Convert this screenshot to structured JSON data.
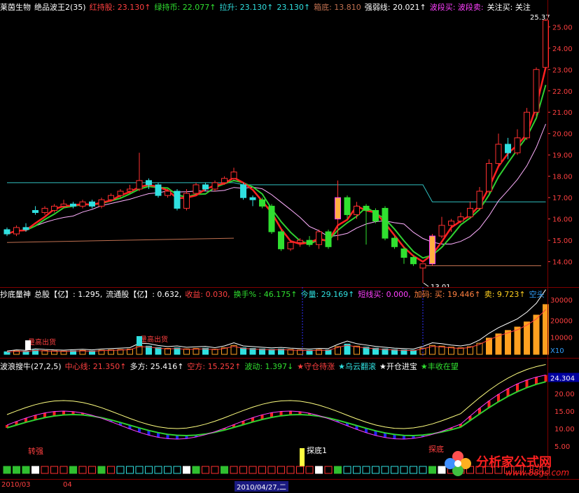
{
  "main_header": {
    "stock": "莱茵生物",
    "indicator": "绝品波王2(35)",
    "items": [
      {
        "label": "红持股: 23.130↑",
        "color": "#ff4040"
      },
      {
        "label": "绿持币: 22.077↑",
        "color": "#30e030"
      },
      {
        "label": "拉升: 23.130↑",
        "color": "#30e0e0"
      },
      {
        "label": "23.130↑",
        "color": "#30e0e0"
      },
      {
        "label": "箱底: 13.810",
        "color": "#c07050"
      },
      {
        "label": "强弱线: 20.021↑",
        "color": "#ffffff"
      },
      {
        "label": "波段买: 波段卖:",
        "color": "#ff40ff"
      },
      {
        "label": "关注买: 关注",
        "color": "#ffffff"
      }
    ]
  },
  "vol_header": {
    "items": [
      {
        "label": "抄底量神",
        "color": "#ffffff"
      },
      {
        "label": "总股【亿】: 1.295,",
        "color": "#ffffff"
      },
      {
        "label": "流通股【亿】: 0.632,",
        "color": "#ffffff"
      },
      {
        "label": "收益: 0.030,",
        "color": "#ff4040"
      },
      {
        "label": "换手% : 46.175↑",
        "color": "#30e030"
      },
      {
        "label": "今量: 29.169↑",
        "color": "#30e0e0"
      },
      {
        "label": "短线买: 0.000,",
        "color": "#ff40ff"
      },
      {
        "label": "加码: 买: 19.446↑",
        "color": "#ff8040"
      },
      {
        "label": "卖: 9.723↑",
        "color": "#ffd020"
      },
      {
        "label": "空头",
        "color": "#30a0ff"
      }
    ]
  },
  "wave_header": {
    "items": [
      {
        "label": "波浪搜牛(27,2,5)",
        "color": "#ffffff"
      },
      {
        "label": "中心线: 21.350↑",
        "color": "#ff4040"
      },
      {
        "label": "多方: 25.416↑",
        "color": "#ffffff"
      },
      {
        "label": "空方: 15.252↑",
        "color": "#ff4040"
      },
      {
        "label": "波动: 1.397↓",
        "color": "#30e030"
      },
      {
        "label": "★守仓待涨",
        "color": "#ff4040"
      },
      {
        "label": "★乌云翻滚",
        "color": "#30e0e0"
      },
      {
        "label": "★开仓进宝",
        "color": "#ffffff"
      },
      {
        "label": "★丰收在望",
        "color": "#30e030"
      }
    ]
  },
  "price_axis": [
    "25.00",
    "24.00",
    "23.00",
    "22.00",
    "21.00",
    "20.00",
    "19.00",
    "18.00",
    "17.00",
    "16.00",
    "15.00",
    "14.00"
  ],
  "vol_axis": [
    "30000",
    "20000",
    "10000",
    "X10"
  ],
  "wave_axis": [
    "24.304",
    "20.00",
    "15.00",
    "10.00",
    "5.00"
  ],
  "annotations": {
    "high_price": "25.37",
    "low_price": "13.01",
    "vol_note1": "量高出货",
    "vol_note2": "量高出货",
    "wave_note1": "转强",
    "wave_note2": "探底1",
    "wave_note3": "探底"
  },
  "dates": {
    "d1": "2010/03",
    "d2": "04",
    "d3": "2010/04/27,二"
  },
  "logo": {
    "title": "分析家公式网",
    "url": "www.88gs.com"
  },
  "candles": [
    {
      "o": 15.5,
      "c": 15.3,
      "h": 15.6,
      "l": 15.2
    },
    {
      "o": 15.3,
      "c": 15.6,
      "h": 15.7,
      "l": 15.2
    },
    {
      "o": 15.6,
      "c": 15.5,
      "h": 15.8,
      "l": 15.4
    },
    {
      "o": 16.4,
      "c": 16.3,
      "h": 16.6,
      "l": 16.2
    },
    {
      "o": 16.3,
      "c": 16.5,
      "h": 16.6,
      "l": 16.2
    },
    {
      "o": 16.4,
      "c": 16.6,
      "h": 16.7,
      "l": 16.3
    },
    {
      "o": 16.6,
      "c": 16.7,
      "h": 16.9,
      "l": 16.5
    },
    {
      "o": 16.7,
      "c": 16.6,
      "h": 16.8,
      "l": 16.5
    },
    {
      "o": 16.6,
      "c": 16.8,
      "h": 16.9,
      "l": 16.5
    },
    {
      "o": 16.8,
      "c": 16.6,
      "h": 16.9,
      "l": 16.5
    },
    {
      "o": 16.6,
      "c": 16.9,
      "h": 17.0,
      "l": 16.5
    },
    {
      "o": 16.9,
      "c": 17.1,
      "h": 17.2,
      "l": 16.8
    },
    {
      "o": 17.1,
      "c": 17.3,
      "h": 17.4,
      "l": 17.0
    },
    {
      "o": 17.3,
      "c": 17.4,
      "h": 17.6,
      "l": 17.2
    },
    {
      "o": 17.4,
      "c": 17.8,
      "h": 19.1,
      "l": 17.3
    },
    {
      "o": 17.8,
      "c": 17.6,
      "h": 17.9,
      "l": 17.4
    },
    {
      "o": 17.6,
      "c": 17.1,
      "h": 17.7,
      "l": 17.0
    },
    {
      "o": 17.1,
      "c": 17.3,
      "h": 17.4,
      "l": 17.0
    },
    {
      "o": 17.3,
      "c": 16.5,
      "h": 17.4,
      "l": 16.4
    },
    {
      "o": 16.5,
      "c": 17.2,
      "h": 17.4,
      "l": 16.4
    },
    {
      "o": 17.2,
      "c": 17.6,
      "h": 17.7,
      "l": 17.1
    },
    {
      "o": 17.6,
      "c": 17.4,
      "h": 17.7,
      "l": 17.3
    },
    {
      "o": 17.4,
      "c": 17.7,
      "h": 17.8,
      "l": 17.3
    },
    {
      "o": 17.7,
      "c": 17.9,
      "h": 18.0,
      "l": 17.6
    },
    {
      "o": 17.9,
      "c": 18.2,
      "h": 18.4,
      "l": 17.8
    },
    {
      "o": 17.6,
      "c": 17.0,
      "h": 17.7,
      "l": 16.9
    },
    {
      "o": 17.0,
      "c": 16.9,
      "h": 17.1,
      "l": 16.6
    },
    {
      "o": 16.9,
      "c": 16.6,
      "h": 17.0,
      "l": 16.5
    },
    {
      "o": 16.6,
      "c": 15.4,
      "h": 16.7,
      "l": 15.3
    },
    {
      "o": 15.4,
      "c": 14.6,
      "h": 15.5,
      "l": 14.5
    },
    {
      "o": 14.6,
      "c": 14.9,
      "h": 15.0,
      "l": 14.5
    },
    {
      "o": 14.9,
      "c": 15.0,
      "h": 15.1,
      "l": 14.7
    },
    {
      "o": 15.0,
      "c": 14.8,
      "h": 15.2,
      "l": 14.7
    },
    {
      "o": 14.8,
      "c": 15.4,
      "h": 15.5,
      "l": 14.6
    },
    {
      "o": 15.4,
      "c": 14.7,
      "h": 15.5,
      "l": 14.6
    },
    {
      "o": 16.0,
      "c": 17.0,
      "h": 17.8,
      "l": 15.0
    },
    {
      "o": 17.0,
      "c": 16.2,
      "h": 17.1,
      "l": 16.0
    },
    {
      "o": 16.2,
      "c": 16.6,
      "h": 16.8,
      "l": 16.0
    },
    {
      "o": 16.6,
      "c": 16.4,
      "h": 16.7,
      "l": 14.8
    },
    {
      "o": 16.4,
      "c": 15.9,
      "h": 16.5,
      "l": 15.8
    },
    {
      "o": 16.5,
      "c": 15.1,
      "h": 16.6,
      "l": 15.0
    },
    {
      "o": 15.1,
      "c": 14.7,
      "h": 15.2,
      "l": 14.6
    },
    {
      "o": 14.6,
      "c": 14.2,
      "h": 14.7,
      "l": 13.9
    },
    {
      "o": 14.2,
      "c": 13.9,
      "h": 14.3,
      "l": 13.8
    },
    {
      "o": 13.7,
      "c": 13.9,
      "h": 13.9,
      "l": 13.0
    },
    {
      "o": 13.9,
      "c": 15.2,
      "h": 15.3,
      "l": 13.8
    },
    {
      "o": 15.2,
      "c": 15.7,
      "h": 16.1,
      "l": 15.1
    },
    {
      "o": 15.7,
      "c": 15.9,
      "h": 16.0,
      "l": 15.4
    },
    {
      "o": 15.9,
      "c": 16.1,
      "h": 16.3,
      "l": 15.8
    },
    {
      "o": 16.1,
      "c": 16.5,
      "h": 16.8,
      "l": 16.0
    },
    {
      "o": 16.5,
      "c": 17.3,
      "h": 17.5,
      "l": 16.4
    },
    {
      "o": 17.3,
      "c": 18.6,
      "h": 18.8,
      "l": 17.2
    },
    {
      "o": 18.6,
      "c": 19.5,
      "h": 20.0,
      "l": 18.5
    },
    {
      "o": 19.5,
      "c": 19.1,
      "h": 19.8,
      "l": 18.8
    },
    {
      "o": 19.1,
      "c": 19.8,
      "h": 20.2,
      "l": 19.0
    },
    {
      "o": 19.8,
      "c": 21.0,
      "h": 21.2,
      "l": 19.7
    },
    {
      "o": 21.0,
      "c": 23.0,
      "h": 23.1,
      "l": 20.8
    },
    {
      "o": 23.1,
      "c": 25.3,
      "h": 25.37,
      "l": 23.0
    }
  ]
}
